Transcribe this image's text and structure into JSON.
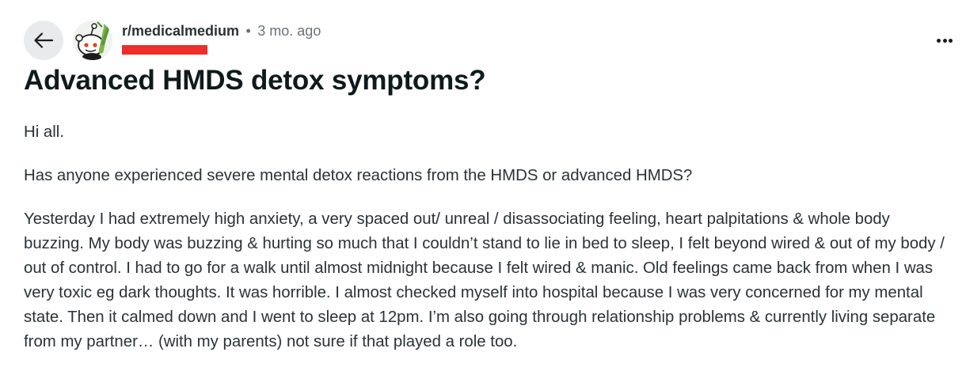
{
  "post": {
    "subreddit": "r/medicalmedium",
    "separator": "•",
    "time_ago": "3 mo. ago",
    "username_redacted": "redacted",
    "title": "Advanced HMDS detox symptoms?",
    "paragraphs": [
      "Hi all.",
      "Has anyone experienced severe mental detox reactions from the HMDS or advanced HMDS?",
      "Yesterday I had extremely high anxiety, a very spaced out/ unreal / disassociating feeling, heart palpitations & whole body buzzing. My body was buzzing & hurting so much that I couldn’t stand to lie in bed to sleep, I felt beyond wired & out of my body / out of control. I had to go for a walk until almost midnight because I felt wired & manic. Old feelings came back from when I was very toxic eg dark thoughts. It was horrible. I almost checked myself into hospital because I was very concerned for my mental state. Then it calmed down and I went to sleep at 12pm. I’m also going through relationship problems & currently living separate from my partner… (with my parents) not sure if that played a role too."
    ]
  },
  "icons": {
    "back": "arrow-left-icon",
    "avatar": "subreddit-avatar",
    "more": "more-horizontal-icon"
  },
  "colors": {
    "back_button_bg": "#e8eaec",
    "redaction": "#ec2f2a",
    "title": "#0f1a1c",
    "body_text": "#2a3236",
    "meta_text": "#6a7276"
  }
}
